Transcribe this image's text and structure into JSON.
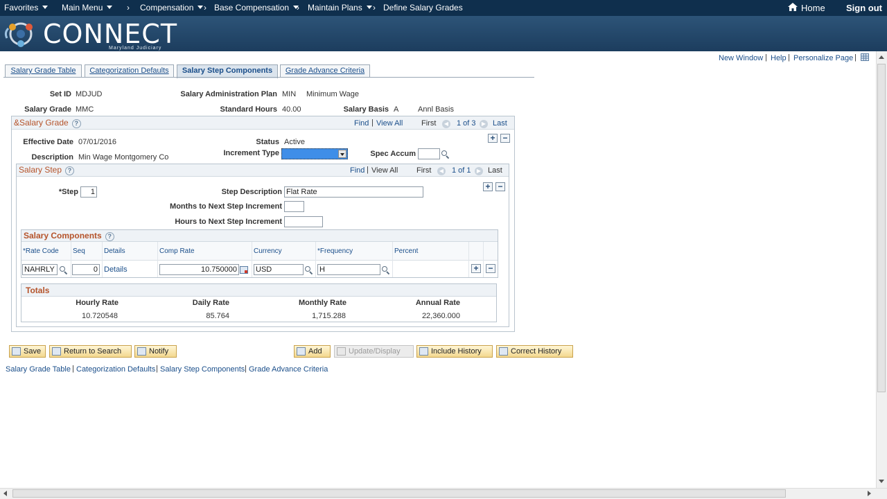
{
  "topnav": {
    "favorites": "Favorites",
    "main_menu": "Main Menu",
    "crumbs": [
      "Compensation",
      "Base Compensation",
      "Maintain Plans",
      "Define Salary Grades"
    ],
    "home": "Home",
    "sign_out": "Sign out"
  },
  "brand": {
    "name": "CONNECT",
    "subtitle": "Maryland Judiciary"
  },
  "toplinks": {
    "new_window": "New Window",
    "help": "Help",
    "personalize": "Personalize Page"
  },
  "tabs": [
    {
      "label": "Salary Grade Table"
    },
    {
      "label": "Categorization Defaults"
    },
    {
      "label": "Salary Step Components"
    },
    {
      "label": "Grade Advance Criteria"
    }
  ],
  "header": {
    "setid_label": "Set ID",
    "setid_value": "MDJUD",
    "plan_label": "Salary Administration Plan",
    "plan_code": "MIN",
    "plan_name": "Minimum Wage",
    "grade_label": "Salary Grade",
    "grade_value": "MMC",
    "hours_label": "Standard Hours",
    "hours_value": "40.00",
    "basis_label": "Salary Basis",
    "basis_code": "A",
    "basis_name": "Annl Basis"
  },
  "salary_grade": {
    "title": "&Salary Grade",
    "find": "Find",
    "view_all": "View All",
    "first": "First",
    "count": "1 of 3",
    "last": "Last",
    "eff_date_label": "Effective Date",
    "eff_date_value": "07/01/2016",
    "status_label": "Status",
    "status_value": "Active",
    "desc_label": "Description",
    "desc_value": "Min Wage Montgomery Co",
    "increment_label": "Increment Type",
    "increment_value": "",
    "spec_accum_label": "Spec Accum",
    "spec_accum_value": ""
  },
  "salary_step": {
    "title": "Salary Step",
    "find": "Find",
    "view_all": "View All",
    "first": "First",
    "count": "1 of 1",
    "last": "Last",
    "step_label": "*Step",
    "step_value": "1",
    "step_desc_label": "Step Description",
    "step_desc_value": "Flat Rate",
    "months_label": "Months to Next Step Increment",
    "months_value": "",
    "hours_label": "Hours to Next Step Increment",
    "hours_value": ""
  },
  "components": {
    "title": "Salary Components",
    "columns": [
      "*Rate Code",
      "Seq",
      "Details",
      "Comp Rate",
      "Currency",
      "*Frequency",
      "Percent"
    ],
    "row": {
      "rate_code": "NAHRLY",
      "seq": "0",
      "details": "Details",
      "comp_rate": "10.750000",
      "currency": "USD",
      "frequency": "H",
      "percent": ""
    }
  },
  "totals": {
    "title": "Totals",
    "headers": [
      "Hourly Rate",
      "Daily Rate",
      "Monthly Rate",
      "Annual Rate"
    ],
    "values": [
      "10.720548",
      "85.764",
      "1,715.288",
      "22,360.000"
    ]
  },
  "buttons": {
    "save": "Save",
    "return": "Return to Search",
    "notify": "Notify",
    "add": "Add",
    "update": "Update/Display",
    "include_history": "Include History",
    "correct_history": "Correct History"
  },
  "bottom_links": [
    "Salary Grade Table",
    "Categorization Defaults",
    "Salary Step Components",
    "Grade Advance Criteria"
  ],
  "colors": {
    "nav": "#0f2f4d",
    "accent": "#b5532a",
    "link": "#1a4e8a"
  }
}
